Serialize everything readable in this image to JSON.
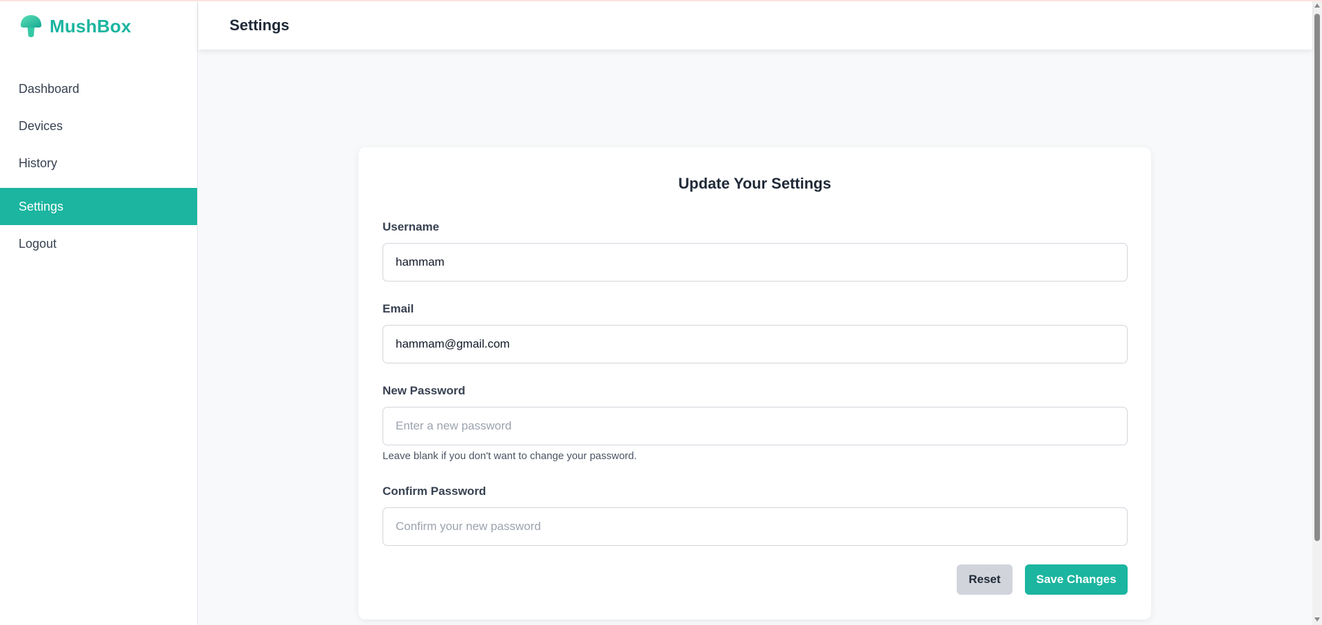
{
  "app": {
    "name": "MushBox",
    "logo_icon": "mushroom-icon",
    "accent_color": "#1bb5a0"
  },
  "sidebar": {
    "items": [
      {
        "label": "Dashboard",
        "active": false
      },
      {
        "label": "Devices",
        "active": false
      },
      {
        "label": "History",
        "active": false
      },
      {
        "label": "Settings",
        "active": true
      },
      {
        "label": "Logout",
        "active": false
      }
    ]
  },
  "header": {
    "title": "Settings"
  },
  "form": {
    "title": "Update Your Settings",
    "username": {
      "label": "Username",
      "value": "hammam"
    },
    "email": {
      "label": "Email",
      "value": "hammam@gmail.com"
    },
    "new_password": {
      "label": "New Password",
      "placeholder": "Enter a new password",
      "help": "Leave blank if you don't want to change your password."
    },
    "confirm_password": {
      "label": "Confirm Password",
      "placeholder": "Confirm your new password"
    },
    "reset_label": "Reset",
    "save_label": "Save Changes"
  }
}
